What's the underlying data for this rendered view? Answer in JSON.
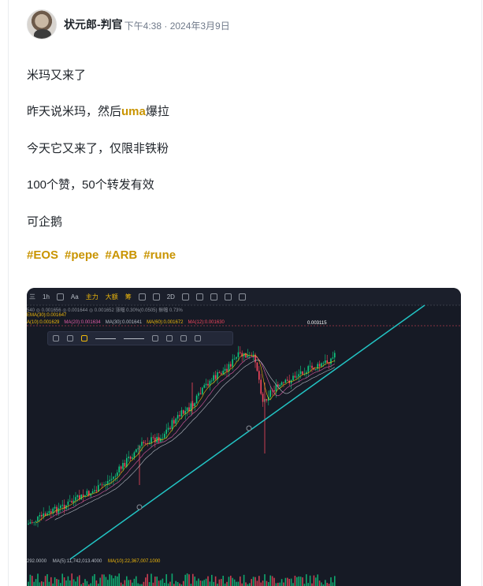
{
  "post": {
    "author": "状元郎-判官",
    "time": "下午4:38 · 2024年3月9日",
    "lines": [
      "米玛又来了",
      "昨天说米玛，然后",
      "uma",
      "爆拉",
      "今天它又来了，仅限非铁粉",
      "100个赞，50个转发有效",
      "可企鹅"
    ],
    "tags": [
      "#EOS",
      "#pepe",
      "#ARB",
      "#rune"
    ]
  },
  "chart": {
    "toolbar": [
      "三",
      "1h",
      "Aa",
      "主力",
      "大额",
      "筹",
      "2D"
    ],
    "ind_row1": "540 ◎ 0.001656 ◎ 0.001644 ◎ 0.001652 涨幅 0.30%(0.0505) 振幅 0.73%",
    "ind_ema": "EMA(30):0.001647",
    "ind_ma": [
      "A(10):0.001629",
      "MA(20):0.001634",
      "MA(30):0.001641",
      "MA(60):0.001672",
      "MA(12):0.001630"
    ],
    "price_label": "0.003115",
    "vol_left": "292.0000",
    "vol_ma5": "MA(5):11,742,013.4000",
    "vol_ma10": "MA(10):22,367,007.1000",
    "colors": {
      "up": "#0ecb81",
      "down": "#f6465d",
      "trend": "#22c3c3",
      "bg": "#161a25"
    }
  }
}
